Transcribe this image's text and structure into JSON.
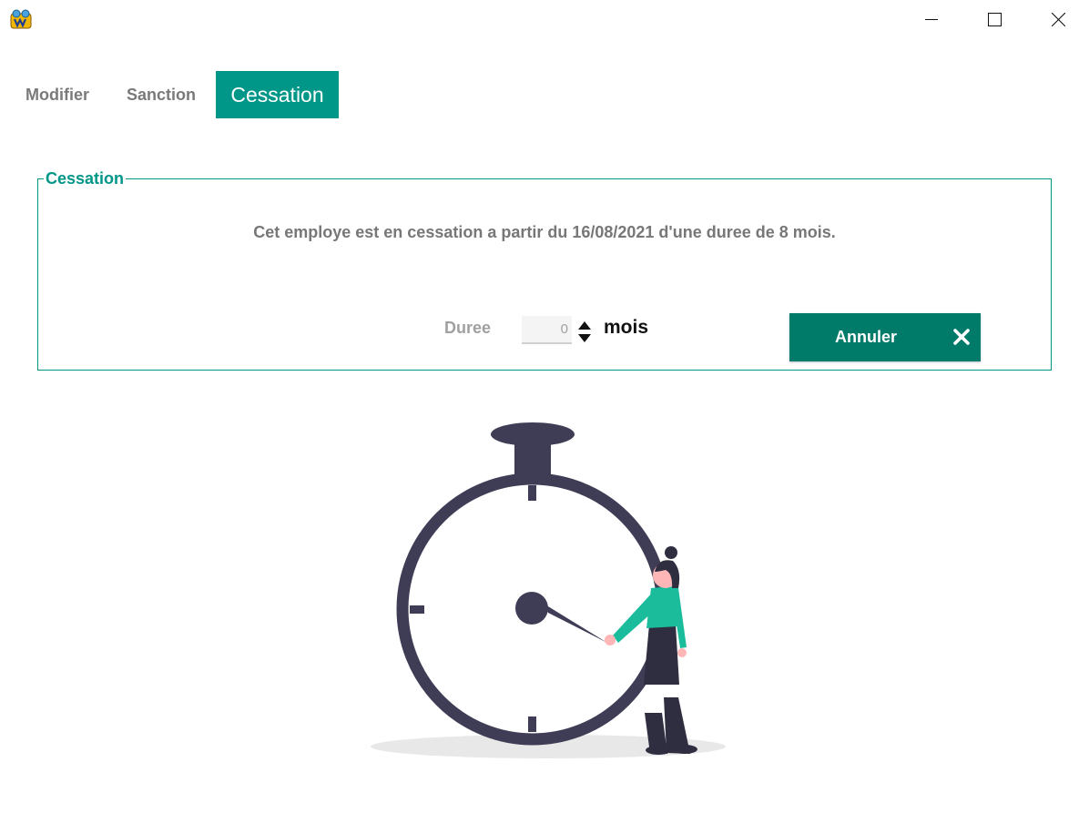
{
  "window": {
    "controls": {
      "minimize": "minimize",
      "maximize": "maximize",
      "close": "close"
    }
  },
  "tabs": [
    {
      "label": "Modifier",
      "active": false
    },
    {
      "label": "Sanction",
      "active": false
    },
    {
      "label": "Cessation",
      "active": true
    }
  ],
  "panel": {
    "legend": "Cessation",
    "message": "Cet employe est en cessation a partir du 16/08/2021 d'une duree de 8 mois.",
    "duree_label": "Duree",
    "duree_value": "0",
    "unit_label": "mois",
    "cancel_button": "Annuler"
  },
  "colors": {
    "accent": "#009688",
    "button": "#007a69",
    "tab_inactive_text": "#7a7a7a",
    "clock": "#3f3d56"
  },
  "icons": [
    "app-icon",
    "minimize-icon",
    "maximize-icon",
    "close-icon",
    "spinner-arrows-icon",
    "cancel-x-icon"
  ]
}
